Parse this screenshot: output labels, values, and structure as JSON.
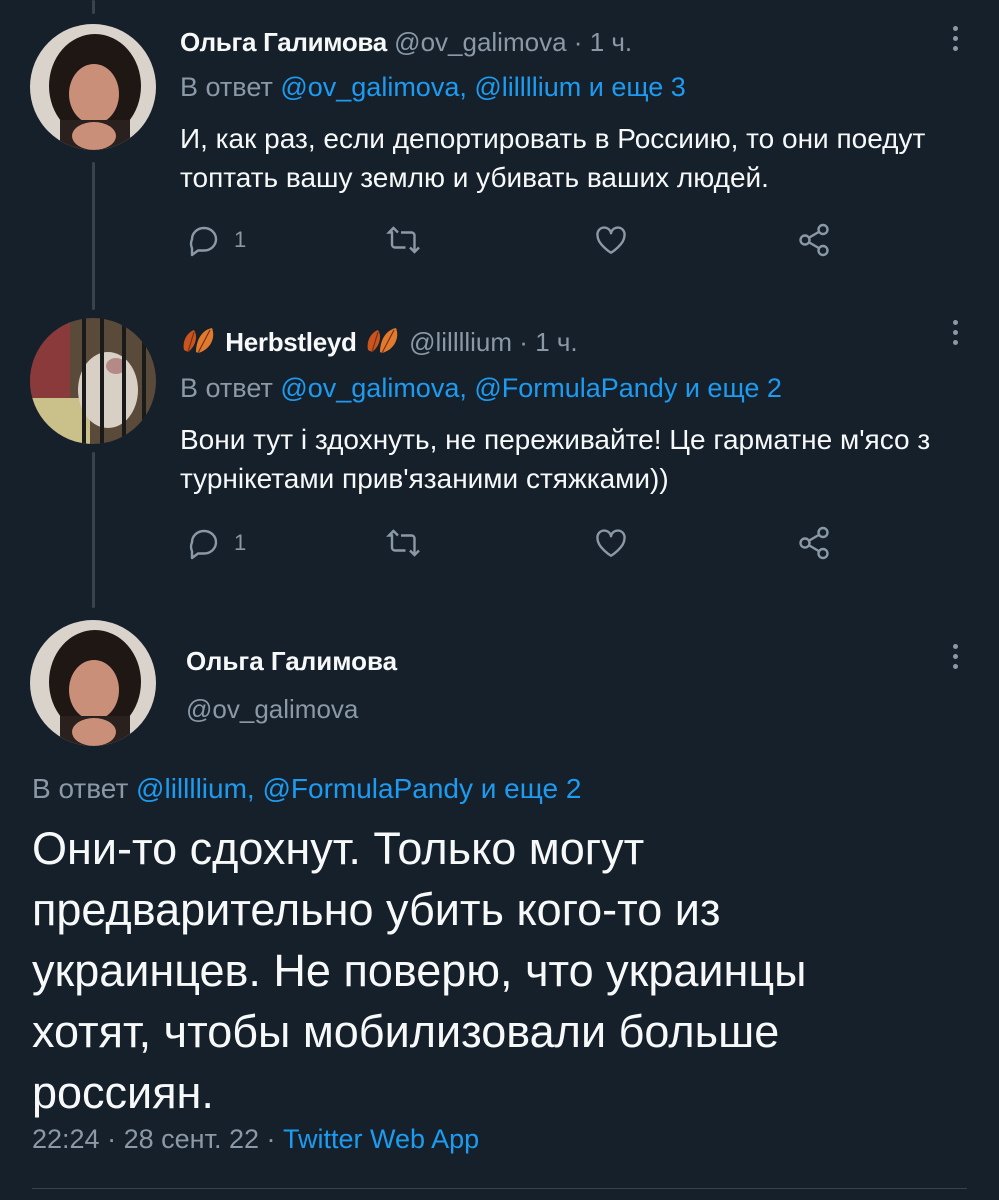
{
  "tweet1": {
    "name": "Ольга Галимова",
    "handle": "@ov_galimova",
    "dot": "·",
    "time": "1 ч.",
    "reply_prefix": "В ответ",
    "reply_mentions": "@ov_galimova, @lillllium",
    "reply_more": "и еще 3",
    "text": "И, как раз, если депортировать в Россиию, то они поедут топтать вашу землю и убивать ваших людей.",
    "reply_count": "1"
  },
  "tweet2": {
    "name": "Herbstleyd",
    "handle": "@lillllium",
    "dot": "·",
    "time": "1 ч.",
    "reply_prefix": "В ответ",
    "reply_mentions": "@ov_galimova, @FormulaPandy",
    "reply_more": "и еще 2",
    "text": "Вони тут і здохнуть, не переживайте! Це гарматне м'ясо з турнікетами прив'язаними стяжками))",
    "reply_count": "1"
  },
  "main_tweet": {
    "name": "Ольга Галимова",
    "handle": "@ov_galimova",
    "reply_prefix": "В ответ",
    "reply_mentions": "@lillllium, @FormulaPandy",
    "reply_more": "и еще 2",
    "text": "Они-то сдохнут. Только могут предварительно убить кого-то из украинцев. Не поверю, что украинцы хотят, чтобы мобилизовали больше россиян.",
    "time": "22:24",
    "dot1": "·",
    "date": "28 сент. 22",
    "dot2": "·",
    "source": "Twitter Web App"
  },
  "icons": {
    "reply": "reply-icon",
    "retweet": "retweet-icon",
    "like": "heart-icon",
    "share": "share-icon",
    "more": "more-vertical-icon",
    "leaf": "autumn-leaf-icon"
  },
  "colors": {
    "background": "#15202b",
    "text": "#f7f9f9",
    "secondary": "#8b98a5",
    "link": "#1d9bf0",
    "divider": "#38444d"
  }
}
